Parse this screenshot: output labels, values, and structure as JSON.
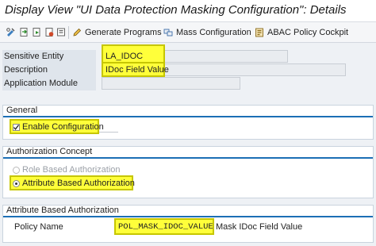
{
  "window": {
    "title": "Display View \"UI Data Protection Masking Configuration\": Details"
  },
  "toolbar": {
    "generate_programs_label": "Generate Programs",
    "mass_configuration_label": "Mass Configuration",
    "abac_policy_cockpit_label": "ABAC Policy Cockpit"
  },
  "header_fields": {
    "sensitive_entity": {
      "label": "Sensitive Entity",
      "value": "LA_IDOC"
    },
    "description": {
      "label": "Description",
      "value": "IDoc Field Value"
    },
    "application_module": {
      "label": "Application Module",
      "value": ""
    }
  },
  "general": {
    "title": "General",
    "enable_configuration": {
      "label": "Enable Configuration",
      "checked": true
    }
  },
  "authorization_concept": {
    "title": "Authorization Concept",
    "options": [
      {
        "label": "Role Based Authorization",
        "selected": false,
        "enabled": false
      },
      {
        "label": "Attribute Based Authorization",
        "selected": true,
        "enabled": true
      }
    ]
  },
  "attribute_based_authorization": {
    "title": "Attribute Based Authorization",
    "policy_name_label": "Policy Name",
    "policy_name_value": "POL_MASK_IDOC_VALUE",
    "policy_description": "Mask IDoc Field Value"
  },
  "colors": {
    "highlight": "#ffff3a",
    "section_accent": "#1c6fb5",
    "label_bg": "#dfe5ec"
  }
}
